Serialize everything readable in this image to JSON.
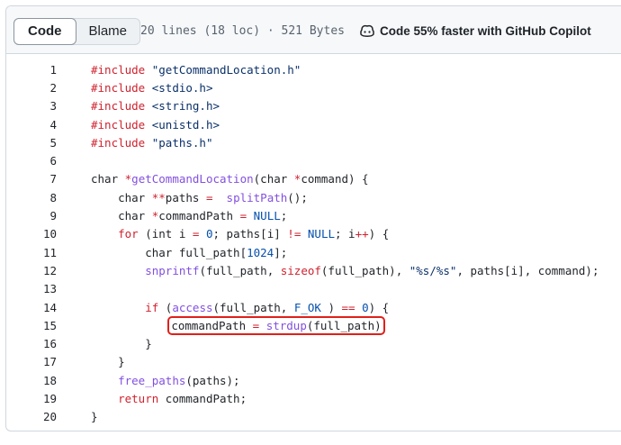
{
  "toolbar": {
    "tabs": [
      {
        "label": "Code",
        "active": true
      },
      {
        "label": "Blame",
        "active": false
      }
    ],
    "file_info": "20 lines (18 loc) · 521 Bytes",
    "copilot_label": "Code 55% faster with GitHub Copilot",
    "copilot_icon": "copilot-icon"
  },
  "colors": {
    "keyword": "#cf222e",
    "function": "#8250df",
    "string": "#0a3069",
    "constant": "#0550ae",
    "highlight_box": "#e0201b"
  },
  "highlighted_line": 15,
  "code": {
    "lines": [
      {
        "n": "1",
        "t": [
          [
            "k",
            "#include"
          ],
          [
            "",
            ""
          ],
          [
            "s",
            " \"getCommandLocation.h\""
          ]
        ]
      },
      {
        "n": "2",
        "t": [
          [
            "k",
            "#include"
          ],
          [
            "s",
            " <stdio.h>"
          ]
        ]
      },
      {
        "n": "3",
        "t": [
          [
            "k",
            "#include"
          ],
          [
            "s",
            " <string.h>"
          ]
        ]
      },
      {
        "n": "4",
        "t": [
          [
            "k",
            "#include"
          ],
          [
            "s",
            " <unistd.h>"
          ]
        ]
      },
      {
        "n": "5",
        "t": [
          [
            "k",
            "#include"
          ],
          [
            "s",
            " \"paths.h\""
          ]
        ]
      },
      {
        "n": "6",
        "t": []
      },
      {
        "n": "7",
        "t": [
          [
            "",
            "char "
          ],
          [
            "k",
            "*"
          ],
          [
            "f",
            "getCommandLocation"
          ],
          [
            "",
            "(char "
          ],
          [
            "k",
            "*"
          ],
          [
            "",
            "command) {"
          ]
        ]
      },
      {
        "n": "8",
        "t": [
          [
            "",
            "    char "
          ],
          [
            "k",
            "**"
          ],
          [
            "",
            "paths "
          ],
          [
            "k",
            "="
          ],
          [
            "",
            "  "
          ],
          [
            "f",
            "splitPath"
          ],
          [
            "",
            "();"
          ]
        ]
      },
      {
        "n": "9",
        "t": [
          [
            "",
            "    char "
          ],
          [
            "k",
            "*"
          ],
          [
            "",
            "commandPath "
          ],
          [
            "k",
            "="
          ],
          [
            "",
            " "
          ],
          [
            "n",
            "NULL"
          ],
          [
            "",
            ";"
          ]
        ]
      },
      {
        "n": "10",
        "t": [
          [
            "",
            "    "
          ],
          [
            "k",
            "for"
          ],
          [
            "",
            " (int i "
          ],
          [
            "k",
            "="
          ],
          [
            "",
            " "
          ],
          [
            "n",
            "0"
          ],
          [
            "",
            "; paths[i] "
          ],
          [
            "k",
            "!="
          ],
          [
            "",
            " "
          ],
          [
            "n",
            "NULL"
          ],
          [
            "",
            "; i"
          ],
          [
            "k",
            "++"
          ],
          [
            "",
            ") {"
          ]
        ]
      },
      {
        "n": "11",
        "t": [
          [
            "",
            "        char full_path["
          ],
          [
            "n",
            "1024"
          ],
          [
            "",
            "];"
          ]
        ]
      },
      {
        "n": "12",
        "t": [
          [
            "",
            "        "
          ],
          [
            "f",
            "snprintf"
          ],
          [
            "",
            "(full_path, "
          ],
          [
            "k",
            "sizeof"
          ],
          [
            "",
            "(full_path), "
          ],
          [
            "s",
            "\"%s/%s\""
          ],
          [
            "",
            ", paths[i], command);"
          ]
        ]
      },
      {
        "n": "13",
        "t": []
      },
      {
        "n": "14",
        "t": [
          [
            "",
            "        "
          ],
          [
            "k",
            "if"
          ],
          [
            "",
            " ("
          ],
          [
            "f",
            "access"
          ],
          [
            "",
            "(full_path, "
          ],
          [
            "n",
            "F_OK"
          ],
          [
            "",
            " ) "
          ],
          [
            "k",
            "=="
          ],
          [
            "",
            " "
          ],
          [
            "n",
            "0"
          ],
          [
            "",
            ") {"
          ]
        ]
      },
      {
        "n": "15",
        "t": [
          [
            "",
            "            "
          ],
          [
            "hl",
            ""
          ],
          [
            "",
            "commandPath "
          ],
          [
            "k",
            "="
          ],
          [
            "",
            " "
          ],
          [
            "f",
            "strdup"
          ],
          [
            "",
            "(full_path)"
          ],
          [
            "hlend",
            ""
          ]
        ]
      },
      {
        "n": "16",
        "t": [
          [
            "",
            "        }"
          ]
        ]
      },
      {
        "n": "17",
        "t": [
          [
            "",
            "    }"
          ]
        ]
      },
      {
        "n": "18",
        "t": [
          [
            "",
            "    "
          ],
          [
            "f",
            "free_paths"
          ],
          [
            "",
            "(paths);"
          ]
        ]
      },
      {
        "n": "19",
        "t": [
          [
            "",
            "    "
          ],
          [
            "k",
            "return"
          ],
          [
            "",
            " commandPath;"
          ]
        ]
      },
      {
        "n": "20",
        "t": [
          [
            "",
            "}"
          ]
        ]
      }
    ]
  }
}
